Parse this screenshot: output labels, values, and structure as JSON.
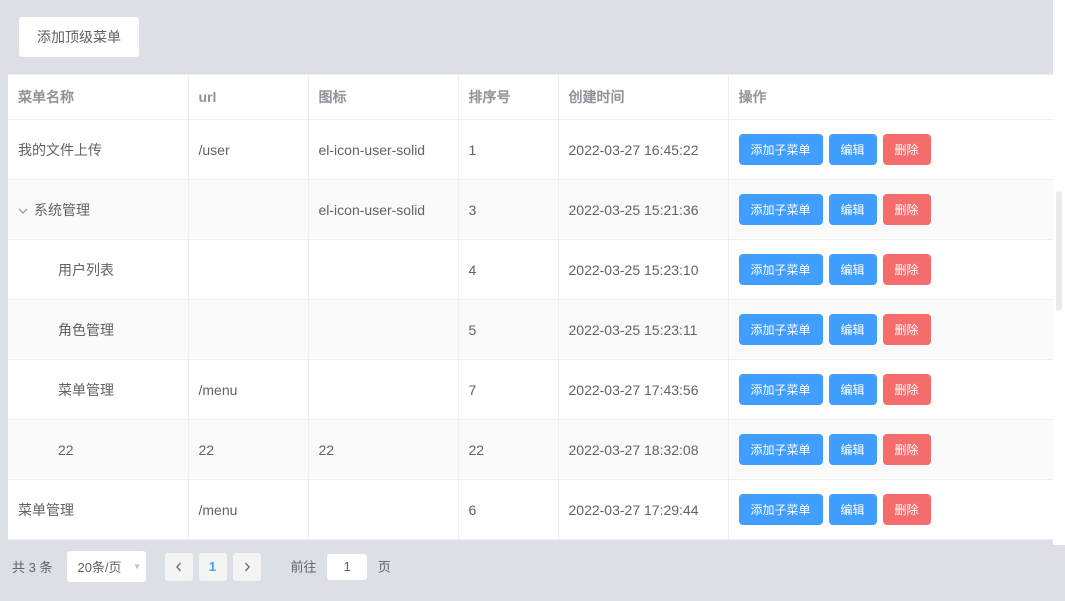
{
  "toolbar": {
    "addTopMenu": "添加顶级菜单"
  },
  "columns": {
    "name": "菜单名称",
    "url": "url",
    "icon": "图标",
    "sort": "排序号",
    "created": "创建时间",
    "actions": "操作"
  },
  "actions": {
    "addChild": "添加子菜单",
    "edit": "编辑",
    "delete": "删除"
  },
  "rows": [
    {
      "name": "我的文件上传",
      "url": "/user",
      "icon": "el-icon-user-solid",
      "sort": "1",
      "created": "2022-03-27 16:45:22",
      "indent": 0,
      "expandable": false,
      "striped": false
    },
    {
      "name": "系统管理",
      "url": "",
      "icon": "el-icon-user-solid",
      "sort": "3",
      "created": "2022-03-25 15:21:36",
      "indent": 0,
      "expandable": true,
      "striped": true
    },
    {
      "name": "用户列表",
      "url": "",
      "icon": "",
      "sort": "4",
      "created": "2022-03-25 15:23:10",
      "indent": 2,
      "expandable": false,
      "striped": false
    },
    {
      "name": "角色管理",
      "url": "",
      "icon": "",
      "sort": "5",
      "created": "2022-03-25 15:23:11",
      "indent": 2,
      "expandable": false,
      "striped": true
    },
    {
      "name": "菜单管理",
      "url": "/menu",
      "icon": "",
      "sort": "7",
      "created": "2022-03-27 17:43:56",
      "indent": 2,
      "expandable": false,
      "striped": false
    },
    {
      "name": "22",
      "url": "22",
      "icon": "22",
      "sort": "22",
      "created": "2022-03-27 18:32:08",
      "indent": 2,
      "expandable": false,
      "striped": true
    },
    {
      "name": "菜单管理",
      "url": "/menu",
      "icon": "",
      "sort": "6",
      "created": "2022-03-27 17:29:44",
      "indent": 0,
      "expandable": false,
      "striped": false
    }
  ],
  "pagination": {
    "totalLabel": "共 3 条",
    "pageSizeLabel": "20条/页",
    "current": "1",
    "jumpPrefix": "前往",
    "jumpValue": "1",
    "jumpSuffix": "页"
  }
}
